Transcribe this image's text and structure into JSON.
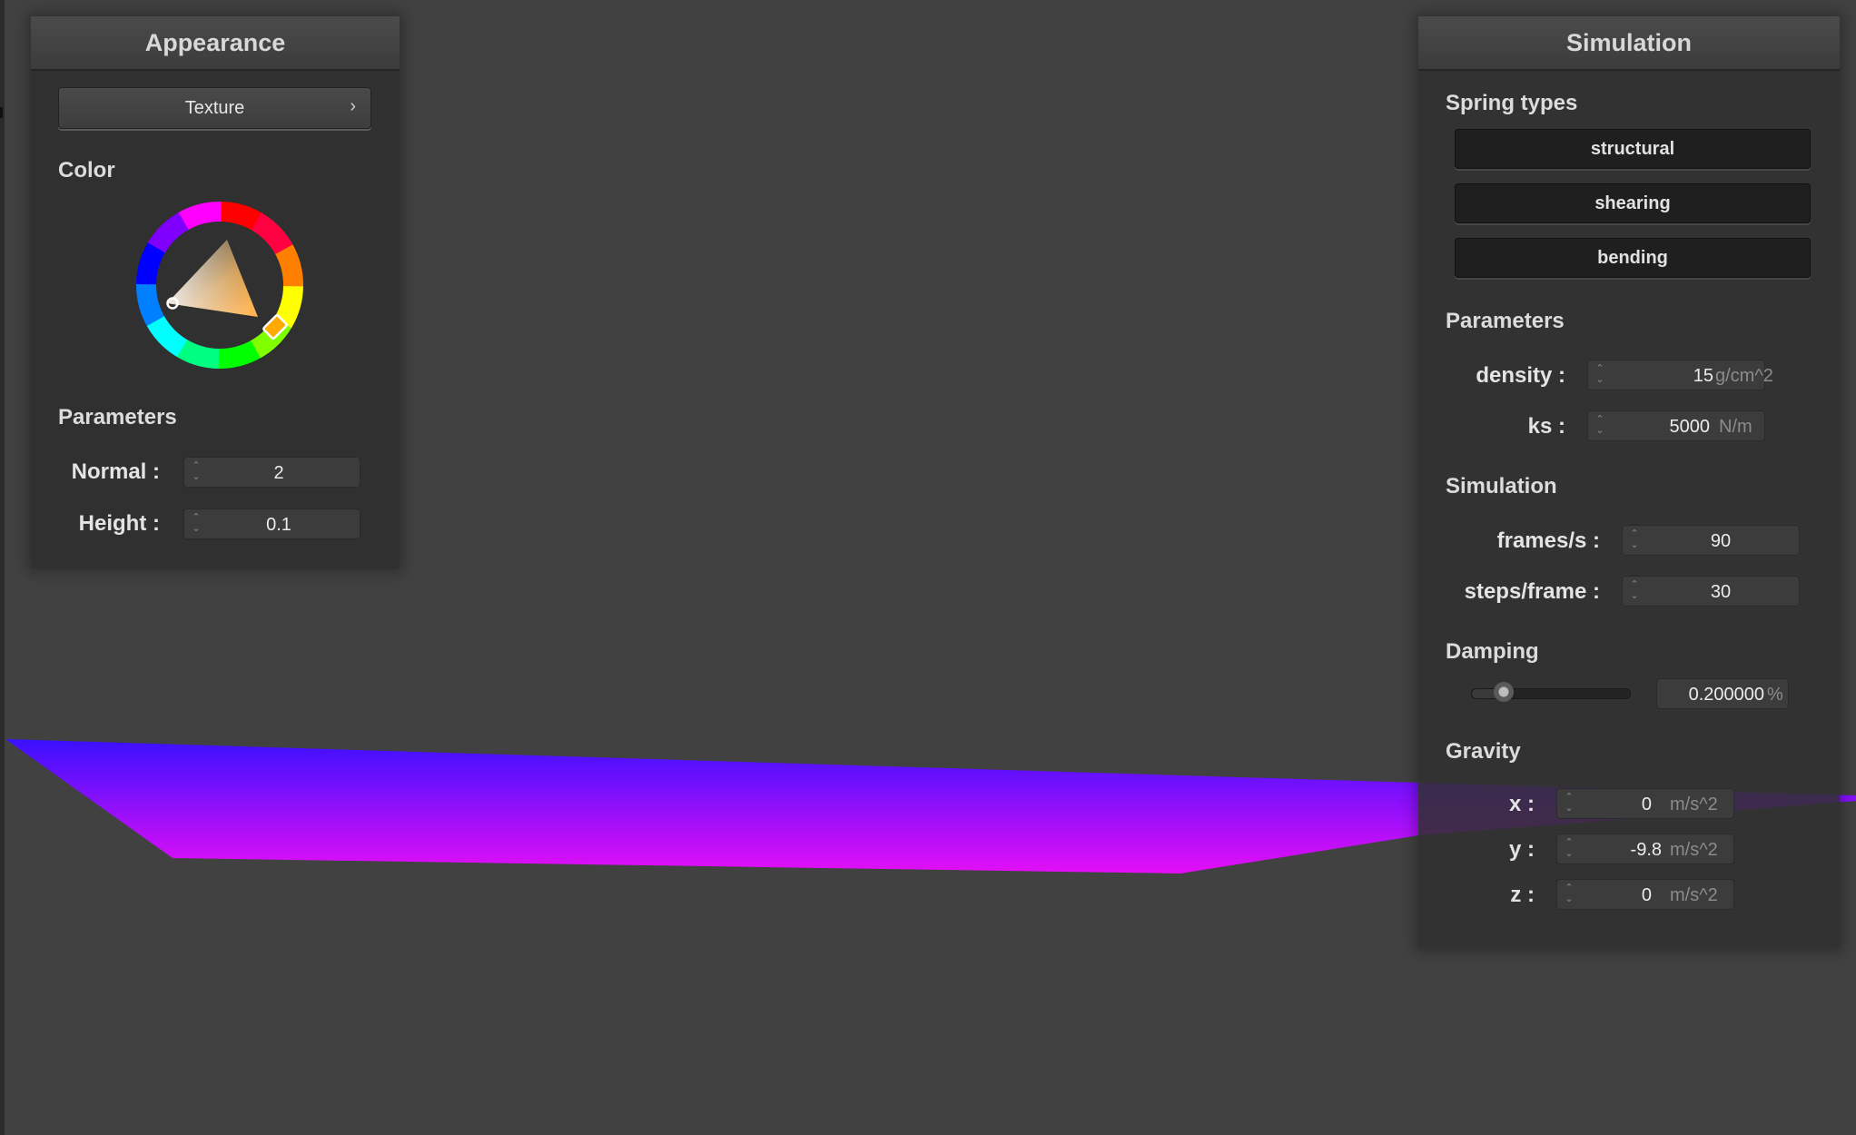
{
  "appearance": {
    "title": "Appearance",
    "texture_button": "Texture",
    "texture_chevron": "›",
    "color_label": "Color",
    "parameters_label": "Parameters",
    "normal": {
      "label": "Normal :",
      "value": "2"
    },
    "height": {
      "label": "Height :",
      "value": "0.1"
    },
    "selected_hue": "#ffaa00",
    "picked_color": "#ffffff"
  },
  "simulation": {
    "title": "Simulation",
    "spring_types_label": "Spring types",
    "spring_types": [
      "structural",
      "shearing",
      "bending"
    ],
    "parameters_label": "Parameters",
    "density": {
      "label": "density :",
      "value": "15",
      "unit": "g/cm^2"
    },
    "ks": {
      "label": "ks :",
      "value": "5000",
      "unit": "N/m"
    },
    "simulation_label": "Simulation",
    "frames_per_second": {
      "label": "frames/s :",
      "value": "90"
    },
    "steps_per_frame": {
      "label": "steps/frame :",
      "value": "30"
    },
    "damping_label": "Damping",
    "damping": {
      "value": "0.200000",
      "unit": "%",
      "slider_fraction": 0.2
    },
    "gravity_label": "Gravity",
    "gravity": [
      {
        "label": "x :",
        "value": "0",
        "unit": "m/s^2"
      },
      {
        "label": "y :",
        "value": "-9.8",
        "unit": "m/s^2"
      },
      {
        "label": "z :",
        "value": "0",
        "unit": "m/s^2"
      }
    ]
  },
  "cloth": {
    "color_top": "#3a10ff",
    "color_bottom": "#e40ff5"
  },
  "icons": {
    "spinner": "up-down-arrows-icon",
    "chevron": "chevron-right-icon"
  }
}
